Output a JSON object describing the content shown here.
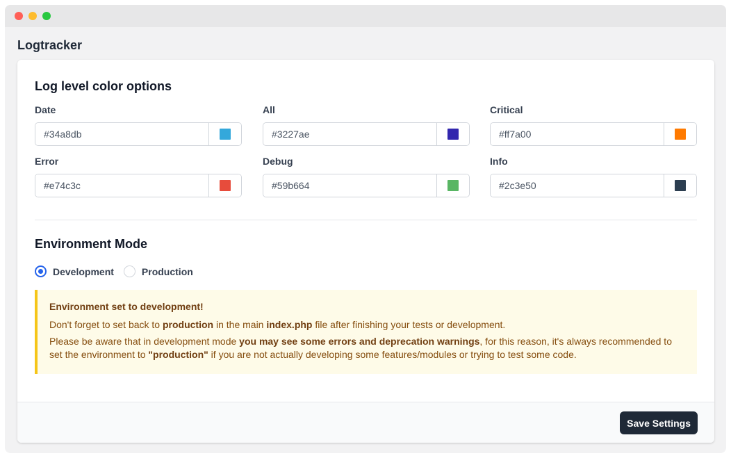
{
  "app": {
    "title": "Logtracker"
  },
  "colors_section": {
    "title": "Log level color options",
    "fields": [
      {
        "label": "Date",
        "value": "#34a8db",
        "color": "#34a8db"
      },
      {
        "label": "All",
        "value": "#3227ae",
        "color": "#3227ae"
      },
      {
        "label": "Critical",
        "value": "#ff7a00",
        "color": "#ff7a00"
      },
      {
        "label": "Error",
        "value": "#e74c3c",
        "color": "#e74c3c"
      },
      {
        "label": "Debug",
        "value": "#59b664",
        "color": "#59b664"
      },
      {
        "label": "Info",
        "value": "#2c3e50",
        "color": "#2c3e50"
      }
    ]
  },
  "environment": {
    "title": "Environment Mode",
    "options": [
      {
        "label": "Development",
        "checked": true
      },
      {
        "label": "Production",
        "checked": false
      }
    ],
    "alert": {
      "title": "Environment set to development!",
      "line1": {
        "a": "Don't forget to set back to ",
        "b": "production",
        "c": " in the main ",
        "d": "index.php",
        "e": " file after finishing your tests or development."
      },
      "line2": {
        "a": "Please be aware that in development mode ",
        "b": "you may see some errors and deprecation warnings",
        "c": ", for this reason, it's always recommended to set the environment to ",
        "d": "\"production\"",
        "e": " if you are not actually developing some features/modules or trying to test some code."
      }
    }
  },
  "footer": {
    "save_label": "Save Settings"
  },
  "theme": {
    "accent": "#2563eb",
    "button_bg": "#1f2937",
    "alert_border": "#f5c518"
  }
}
